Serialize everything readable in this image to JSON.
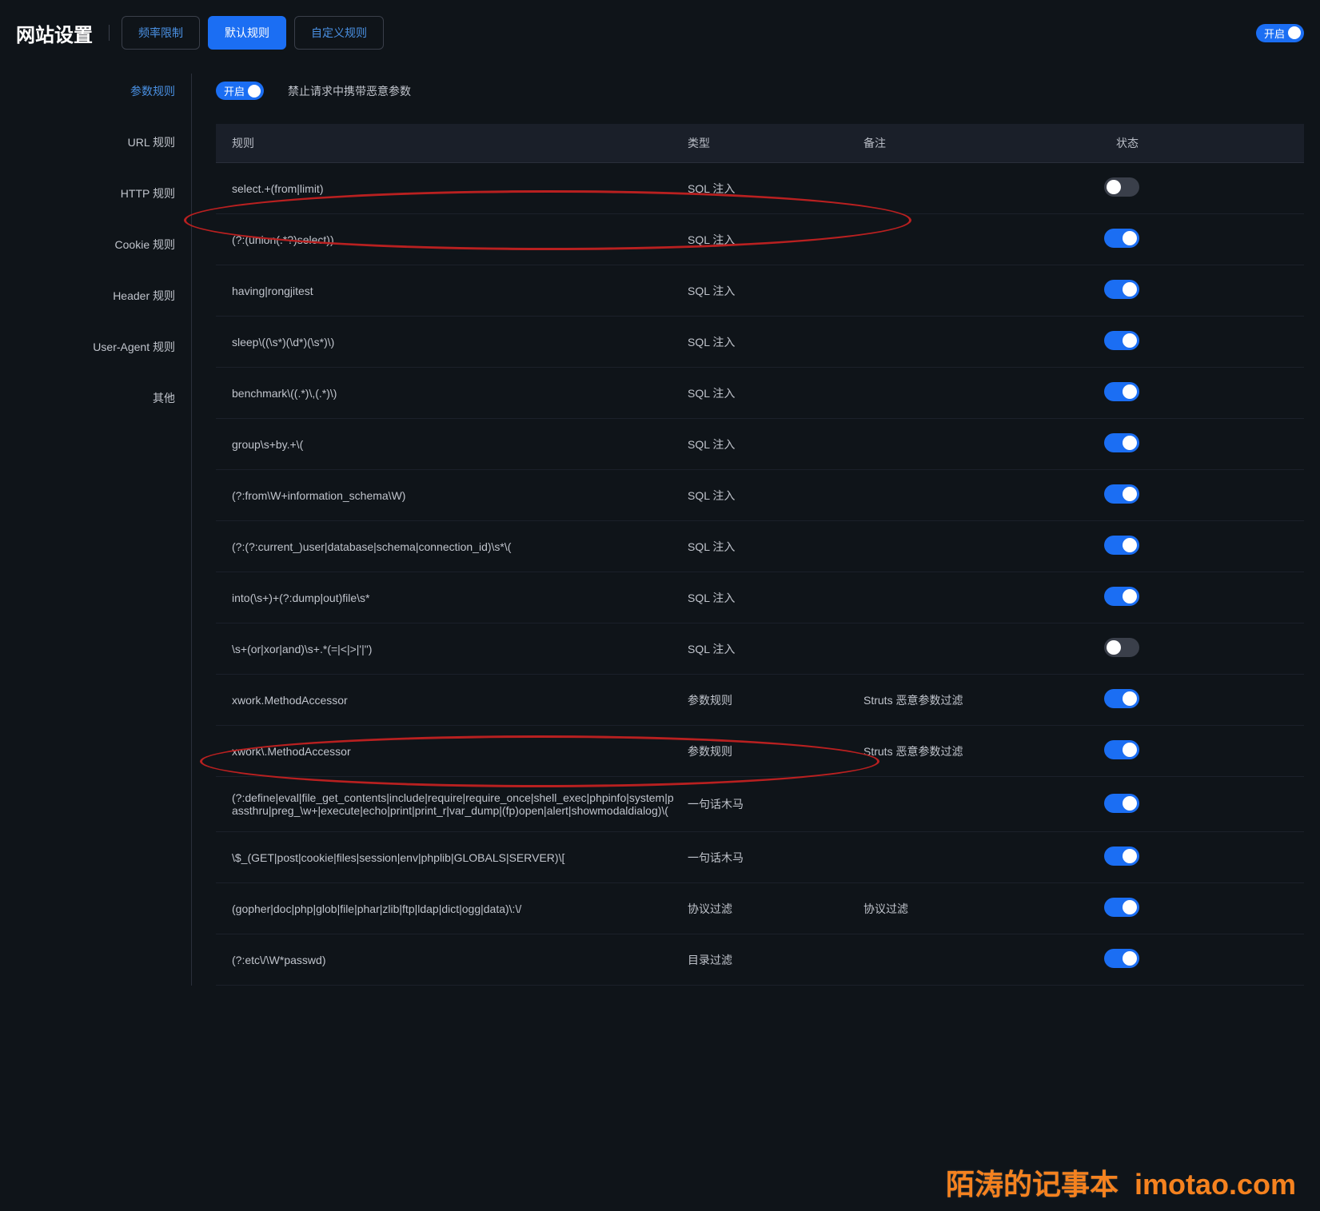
{
  "header": {
    "title": "网站设置",
    "tabs": [
      {
        "label": "频率限制",
        "active": false
      },
      {
        "label": "默认规则",
        "active": true
      },
      {
        "label": "自定义规则",
        "active": false
      }
    ],
    "global_toggle_label": "开启",
    "global_toggle_on": true
  },
  "sidebar": {
    "items": [
      {
        "label": "参数规则",
        "active": true
      },
      {
        "label": "URL 规则",
        "active": false
      },
      {
        "label": "HTTP 规则",
        "active": false
      },
      {
        "label": "Cookie 规则",
        "active": false
      },
      {
        "label": "Header 规则",
        "active": false
      },
      {
        "label": "User-Agent 规则",
        "active": false
      },
      {
        "label": "其他",
        "active": false
      }
    ]
  },
  "sub": {
    "toggle_label": "开启",
    "toggle_on": true,
    "desc": "禁止请求中携带恶意参数"
  },
  "table": {
    "headers": {
      "rule": "规则",
      "type": "类型",
      "note": "备注",
      "status": "状态"
    },
    "rows": [
      {
        "rule": "select.+(from|limit)",
        "type": "SQL 注入",
        "note": "",
        "on": false,
        "highlight": true
      },
      {
        "rule": "(?:(union(.*?)select))",
        "type": "SQL 注入",
        "note": "",
        "on": true
      },
      {
        "rule": "having|rongjitest",
        "type": "SQL 注入",
        "note": "",
        "on": true
      },
      {
        "rule": "sleep\\((\\s*)(\\d*)(\\s*)\\)",
        "type": "SQL 注入",
        "note": "",
        "on": true
      },
      {
        "rule": "benchmark\\((.*)\\,(.*)\\)",
        "type": "SQL 注入",
        "note": "",
        "on": true
      },
      {
        "rule": "group\\s+by.+\\(",
        "type": "SQL 注入",
        "note": "",
        "on": true
      },
      {
        "rule": "(?:from\\W+information_schema\\W)",
        "type": "SQL 注入",
        "note": "",
        "on": true
      },
      {
        "rule": "(?:(?:current_)user|database|schema|connection_id)\\s*\\(",
        "type": "SQL 注入",
        "note": "",
        "on": true
      },
      {
        "rule": "into(\\s+)+(?:dump|out)file\\s*",
        "type": "SQL 注入",
        "note": "",
        "on": true
      },
      {
        "rule": "\\s+(or|xor|and)\\s+.*(=|<|>|'|\")",
        "type": "SQL 注入",
        "note": "",
        "on": false,
        "highlight": true
      },
      {
        "rule": "xwork.MethodAccessor",
        "type": "参数规则",
        "note": "Struts 恶意参数过滤",
        "on": true
      },
      {
        "rule": "xwork\\.MethodAccessor",
        "type": "参数规则",
        "note": "Struts 恶意参数过滤",
        "on": true
      },
      {
        "rule": "(?:define|eval|file_get_contents|include|require|require_once|shell_exec|phpinfo|system|passthru|preg_\\w+|execute|echo|print|print_r|var_dump|(fp)open|alert|showmodaldialog)\\(",
        "type": "一句话木马",
        "note": "",
        "on": true
      },
      {
        "rule": "\\$_(GET|post|cookie|files|session|env|phplib|GLOBALS|SERVER)\\[",
        "type": "一句话木马",
        "note": "",
        "on": true
      },
      {
        "rule": "(gopher|doc|php|glob|file|phar|zlib|ftp|ldap|dict|ogg|data)\\:\\/",
        "type": "协议过滤",
        "note": "协议过滤",
        "on": true
      },
      {
        "rule": "(?:etc\\/\\W*passwd)",
        "type": "目录过滤",
        "note": "",
        "on": true
      }
    ]
  },
  "watermark": {
    "left": "陌涛的记事本",
    "right": "imotao.com"
  }
}
